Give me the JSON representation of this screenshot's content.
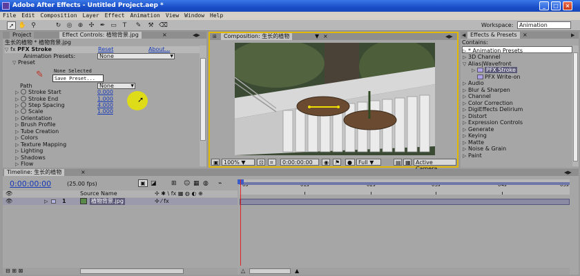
{
  "window": {
    "title": "Adobe After Effects - Untitled Project.aep *"
  },
  "menu": [
    "File",
    "Edit",
    "Composition",
    "Layer",
    "Effect",
    "Animation",
    "View",
    "Window",
    "Help"
  ],
  "toolbar": {
    "workspace_label": "Workspace:",
    "workspace_value": "Animation"
  },
  "project_panel": {
    "tab": "Project"
  },
  "effect_controls": {
    "tab": "Effect Controls: 植物背景.jpg",
    "breadcrumb": "生长的植物 * 植物背景.jpg",
    "effect_name": "PFX Stroke",
    "reset": "Reset",
    "about": "About...",
    "animation_presets_label": "Animation Presets:",
    "animation_presets_value": "None",
    "preset_label": "Preset",
    "preset_none": "None Selected",
    "save_preset": "Save Preset...",
    "path_label": "Path",
    "path_value": "None",
    "params": [
      {
        "name": "Stroke Start",
        "value": "0.000"
      },
      {
        "name": "Stroke End",
        "value": "1.000"
      },
      {
        "name": "Step Spacing",
        "value": "4.000"
      },
      {
        "name": "Scale",
        "value": "1.000"
      }
    ],
    "groups": [
      "Orientation",
      "Brush Profile",
      "Tube Creation",
      "Colors",
      "Texture Mapping",
      "Lighting",
      "Shadows",
      "Flow"
    ]
  },
  "composition": {
    "tab": "Composition: 生长的植物",
    "zoom": "100%",
    "timecode": "0:00:00:00",
    "resolution": "Full",
    "camera": "Active Camera"
  },
  "effects_presets": {
    "tab": "Effects & Presets",
    "contains_label": "Contains:",
    "items": [
      {
        "label": "* Animation Presets",
        "level": 0,
        "expanded": false
      },
      {
        "label": "3D Channel",
        "level": 0,
        "expanded": false
      },
      {
        "label": "Alias|Wavefront",
        "level": 0,
        "expanded": true
      },
      {
        "label": "PFX Stroke",
        "level": 1,
        "selected": true
      },
      {
        "label": "PFX Write-on",
        "level": 1,
        "selected": false
      },
      {
        "label": "Audio",
        "level": 0,
        "expanded": false
      },
      {
        "label": "Blur & Sharpen",
        "level": 0,
        "expanded": false
      },
      {
        "label": "Channel",
        "level": 0,
        "expanded": false
      },
      {
        "label": "Color Correction",
        "level": 0,
        "expanded": false
      },
      {
        "label": "DigiEffects Delirium",
        "level": 0,
        "expanded": false
      },
      {
        "label": "Distort",
        "level": 0,
        "expanded": false
      },
      {
        "label": "Expression Controls",
        "level": 0,
        "expanded": false
      },
      {
        "label": "Generate",
        "level": 0,
        "expanded": false
      },
      {
        "label": "Keying",
        "level": 0,
        "expanded": false
      },
      {
        "label": "Matte",
        "level": 0,
        "expanded": false
      },
      {
        "label": "Noise & Grain",
        "level": 0,
        "expanded": false
      },
      {
        "label": "Paint",
        "level": 0,
        "expanded": false
      }
    ]
  },
  "timeline": {
    "tab": "Timeline: 生长的植物",
    "timecode": "0:00:00:00",
    "fps": "(25.00 fps)",
    "source_name_header": "Source Name",
    "ruler_labels": [
      "0s",
      "01s",
      "02s",
      "03s",
      "04s",
      "05s"
    ],
    "layer": {
      "number": "1",
      "name": "植物背景.jpg"
    }
  }
}
